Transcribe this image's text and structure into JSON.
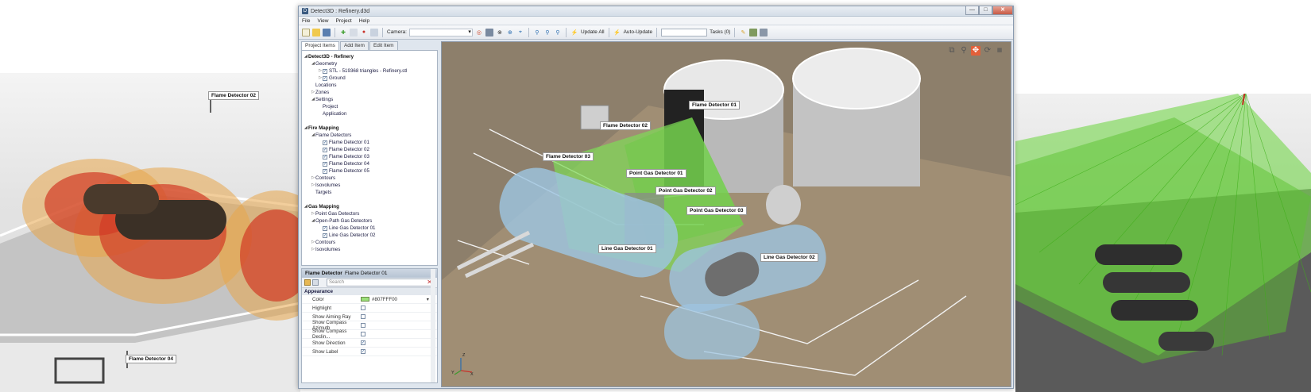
{
  "window": {
    "title": "Detect3D : Refinery.d3d",
    "minimize": "—",
    "maximize": "□",
    "close": "✕"
  },
  "menu": [
    "File",
    "View",
    "Project",
    "Help"
  ],
  "toolbar": {
    "camera_label": "Camera:",
    "update_all": "Update All",
    "auto_update": "Auto-Update",
    "tasks": "Tasks (0)"
  },
  "tabs": [
    "Project Items",
    "Add Item",
    "Edit Item"
  ],
  "tree": [
    {
      "label": "Detect3D - Refinery",
      "level": 0,
      "bold": true,
      "exp": "◢"
    },
    {
      "label": "Geometry",
      "level": 1,
      "exp": "◢"
    },
    {
      "label": "STL - 519368 triangles - Refinery.stl",
      "level": 2,
      "check": true,
      "exp": "▷"
    },
    {
      "label": "Ground",
      "level": 2,
      "check": true,
      "exp": "▷"
    },
    {
      "label": "Locations",
      "level": 1
    },
    {
      "label": "Zones",
      "level": 1,
      "exp": "▷"
    },
    {
      "label": "Settings",
      "level": 1,
      "exp": "◢"
    },
    {
      "label": "Project",
      "level": 2
    },
    {
      "label": "Application",
      "level": 2
    },
    {
      "label": "",
      "level": 0
    },
    {
      "label": "Fire Mapping",
      "level": 0,
      "bold": true,
      "exp": "◢"
    },
    {
      "label": "Flame Detectors",
      "level": 1,
      "exp": "◢"
    },
    {
      "label": "Flame Detector 01",
      "level": 2,
      "check": true
    },
    {
      "label": "Flame Detector 02",
      "level": 2,
      "check": true
    },
    {
      "label": "Flame Detector 03",
      "level": 2,
      "check": true
    },
    {
      "label": "Flame Detector 04",
      "level": 2,
      "check": true
    },
    {
      "label": "Flame Detector 05",
      "level": 2,
      "check": true
    },
    {
      "label": "Contours",
      "level": 1,
      "exp": "▷"
    },
    {
      "label": "Isovolumes",
      "level": 1,
      "exp": "▷"
    },
    {
      "label": "Targets",
      "level": 1
    },
    {
      "label": "",
      "level": 0
    },
    {
      "label": "Gas Mapping",
      "level": 0,
      "bold": true,
      "exp": "◢"
    },
    {
      "label": "Point Gas Detectors",
      "level": 1,
      "exp": "▷"
    },
    {
      "label": "Open-Path Gas Detectors",
      "level": 1,
      "exp": "◢"
    },
    {
      "label": "Line Gas Detector 01",
      "level": 2,
      "check": true
    },
    {
      "label": "Line Gas Detector 02",
      "level": 2,
      "check": true
    },
    {
      "label": "Contours",
      "level": 1,
      "exp": "▷"
    },
    {
      "label": "Isovolumes",
      "level": 1,
      "exp": "▷"
    }
  ],
  "properties": {
    "type": "Flame Detector",
    "item": "Flame Detector 01",
    "search_placeholder": "Search",
    "category": "Appearance",
    "rows": [
      {
        "name": "Color",
        "value": "#807FFF00",
        "swatch": "#9be07a"
      },
      {
        "name": "Highlight",
        "checked": false
      },
      {
        "name": "Show Aiming Ray",
        "checked": false
      },
      {
        "name": "Show Compass Azimuth",
        "checked": false
      },
      {
        "name": "Show Compass Declin...",
        "checked": false
      },
      {
        "name": "Show Direction",
        "checked": true
      },
      {
        "name": "Show Label",
        "checked": true
      }
    ]
  },
  "viewport_labels": {
    "fd01": "Flame Detector 01",
    "fd02": "Flame Detector 02",
    "fd03": "Flame Detector 03",
    "pg01": "Point Gas Detector 01",
    "pg02": "Point Gas Detector 02",
    "pg03": "Point Gas Detector 03",
    "lg01": "Line Gas Detector 01",
    "lg02": "Line Gas Detector 02"
  },
  "left_labels": {
    "fd02": "Flame Detector 02",
    "fd04": "Flame Detector 04"
  },
  "axis": {
    "z": "Z",
    "x": "X",
    "y": "Y"
  },
  "colors": {
    "fire_coverage": "#7ed957",
    "gas_pipe": "#9ec4e0",
    "red_zone": "#d23a25",
    "orange_zone": "#e8a64a"
  }
}
